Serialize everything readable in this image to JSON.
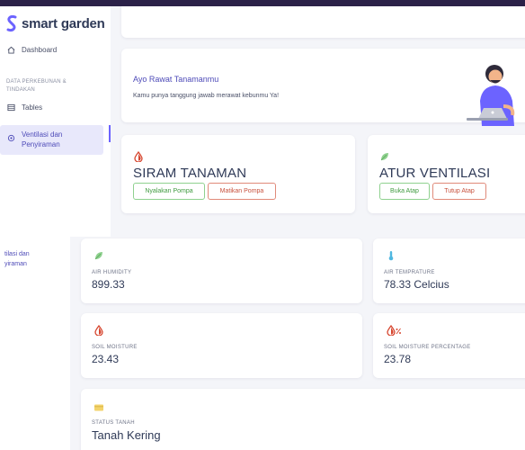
{
  "brand": {
    "name": "smart garden",
    "color": "#6c63ff"
  },
  "sidebar": {
    "dashboard_label": "Dashboard",
    "section_label": "DATA PERKEBUNAN & TINDAKAN",
    "tables_label": "Tables",
    "active_label": "Ventilasi dan Penyiraman",
    "icons": [
      "home-icon",
      "table-icon",
      "settings-icon"
    ]
  },
  "sidebar_bottom": {
    "cropped_label": "tilasi dan\nyiraman"
  },
  "banner": {
    "title": "Ayo Rawat Tanamanmu",
    "subtitle": "Kamu punya tanggung jawab merawat kebunmu Ya!"
  },
  "controls": {
    "siram": {
      "title": "SIRAM TANAMAN",
      "on_label": "Nyalakan Pompa",
      "off_label": "Matikan Pompa",
      "icon": "water-drop-icon"
    },
    "ventilasi": {
      "title": "ATUR VENTILASI",
      "on_label": "Buka Atap",
      "off_label": "Tutup Atap",
      "icon": "leaf-icon"
    }
  },
  "stats": {
    "air_humidity": {
      "label": "AIR HUMIDITY",
      "value": "899.33",
      "icon": "leaf-icon"
    },
    "air_temperature": {
      "label": "AIR TEMPRATURE",
      "value": "78.33 Celcius",
      "icon": "thermometer-icon"
    },
    "soil_moisture": {
      "label": "SOIL MOISTURE",
      "value": "23.43",
      "icon": "water-drop-icon"
    },
    "soil_moisture_pct": {
      "label": "SOIL MOISTURE PERCENTAGE",
      "value": "23.78",
      "icon": "drop-percent-icon"
    },
    "status_tanah": {
      "label": "STATUS TANAH",
      "value": "Tanah Kering",
      "icon": "card-icon"
    }
  },
  "colors": {
    "accent": "#6c63ff",
    "green": "#3f9a3f",
    "red": "#c8513d",
    "background": "#f4f5f9"
  }
}
